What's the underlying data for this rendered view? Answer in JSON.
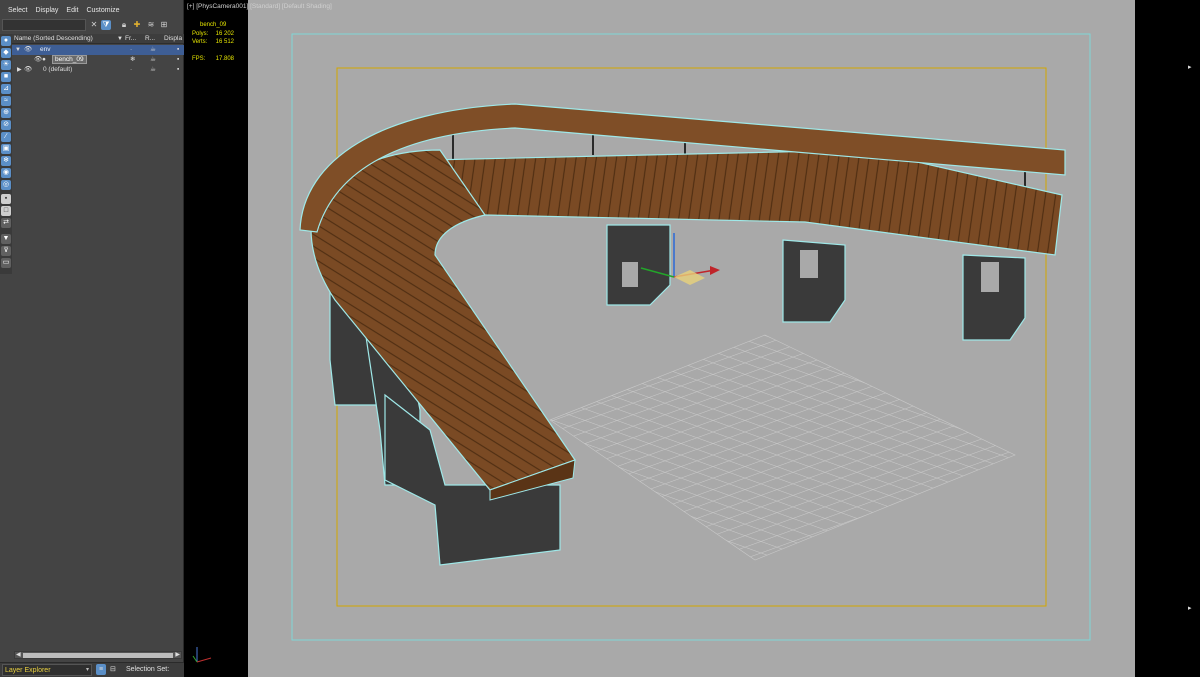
{
  "menu": [
    "Select",
    "Display",
    "Edit",
    "Customize"
  ],
  "columns": {
    "name": "Name (Sorted Descending)",
    "freeze": "Fr...",
    "render": "R...",
    "display": "Displa"
  },
  "tree": [
    {
      "name": "env",
      "level": 0
    },
    {
      "name": "bench_09",
      "level": 1
    },
    {
      "name": "0 (default)",
      "level": 0
    }
  ],
  "status": {
    "explorer_type": "Layer Explorer",
    "selection_set_label": "Selection Set:"
  },
  "viewport": {
    "label_plus": "[+]",
    "label_camera": "[PhysCamera001]",
    "label_standard": "[Standard]",
    "label_shading": "[Default Shading]",
    "stats_object": "bench_09",
    "polys_label": "Polys:",
    "polys_value": "16 202",
    "verts_label": "Verts:",
    "verts_value": "16 512",
    "fps_label": "FPS:",
    "fps_value": "17.808"
  },
  "colors": {
    "wood": "#7a4a24",
    "wood_light": "#8c5a2f",
    "concrete": "#3a3a3a",
    "outline": "#9fe8e8",
    "safe_outer": "#7fd6d6",
    "safe_inner": "#d4a600",
    "grid": "#cfcfcf",
    "highlight": "#3e5e95"
  }
}
